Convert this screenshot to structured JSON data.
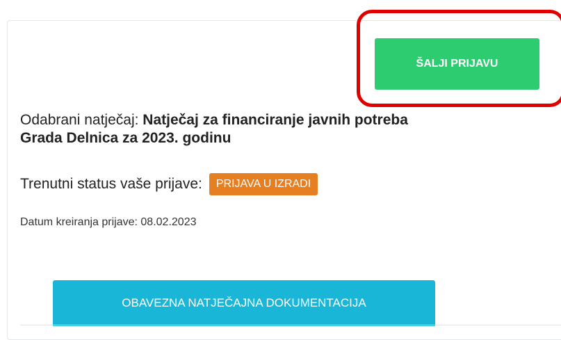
{
  "actions": {
    "send_application_label": "ŠALJI PRIJAVU",
    "mandatory_documents_label": "OBAVEZNA NATJEČAJNA DOKUMENTACIJA"
  },
  "tender": {
    "label": "Odabrani natječaj: ",
    "name_line1": "Natječaj za financiranje javnih potreba",
    "name_line2": "Grada Delnica za 2023. godinu"
  },
  "status": {
    "label": "Trenutni status vaše prijave:",
    "badge": "PRIJAVA U IZRADI"
  },
  "created": {
    "label": "Datum kreiranja prijave: ",
    "date": "08.02.2023"
  },
  "colors": {
    "send_button": "#2ecc71",
    "status_badge": "#e67e22",
    "documents_button": "#1ab6d8",
    "highlight_outline": "#e00000"
  }
}
